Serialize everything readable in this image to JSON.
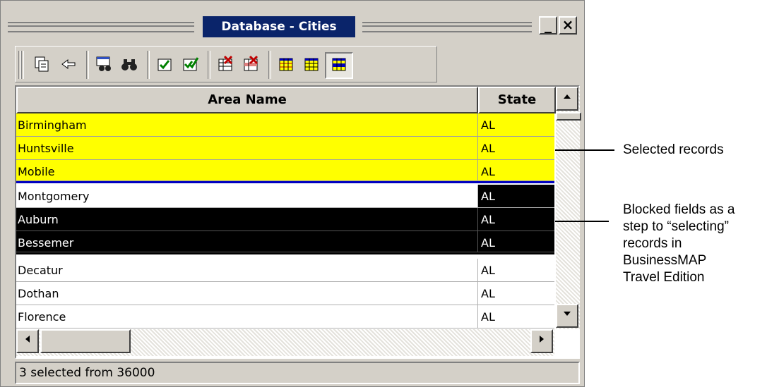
{
  "window": {
    "title": "Database - Cities",
    "minimize_label": "_",
    "close_label": "×"
  },
  "toolbar": {
    "icons": [
      "copy-icon",
      "paste-icon",
      "find-records-icon",
      "binoculars-icon",
      "select-checked-icon",
      "select-all-checked-icon",
      "clear-selection-icon",
      "clear-all-selection-icon",
      "grid-yellow-icon",
      "grid-yellow-blue-icon",
      "grid-blue-icon"
    ]
  },
  "table": {
    "columns": [
      "Area Name",
      "State"
    ],
    "rows": [
      {
        "name": "Birmingham",
        "state": "AL"
      },
      {
        "name": "Huntsville",
        "state": "AL"
      },
      {
        "name": "Mobile",
        "state": "AL"
      },
      {
        "name": "Montgomery",
        "state": "AL"
      },
      {
        "name": "Auburn",
        "state": "AL"
      },
      {
        "name": "Bessemer",
        "state": "AL"
      },
      {
        "name": "Decatur",
        "state": "AL"
      },
      {
        "name": "Dothan",
        "state": "AL"
      },
      {
        "name": "Florence",
        "state": "AL"
      }
    ]
  },
  "status": {
    "text": "3 selected from 36000"
  },
  "callouts": {
    "selected": "Selected records",
    "blocked": [
      "Blocked fields as a",
      "step to “selecting”",
      "records in",
      "BusinessMAP",
      "Travel Edition"
    ]
  },
  "colors": {
    "selected": "#ffff00",
    "blocked": "#000000",
    "title_bar": "#0a246a"
  }
}
